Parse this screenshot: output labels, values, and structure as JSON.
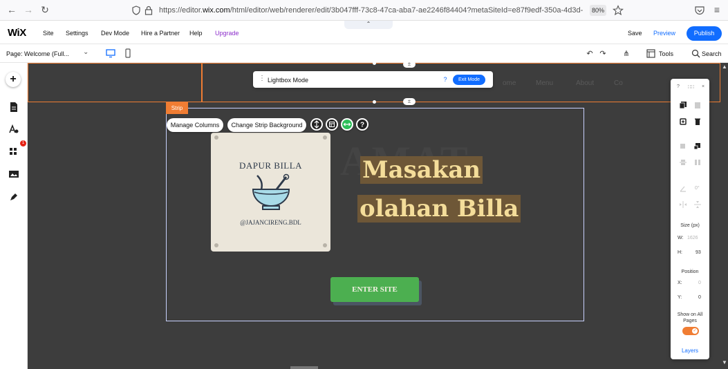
{
  "browser": {
    "url_prefix": "https://editor.",
    "url_domain": "wix.com",
    "url_rest": "/html/editor/web/renderer/edit/3b047fff-73c8-47ca-aba7-ae2246f84404?metaSiteId=e87f9edf-350a-4d3d-",
    "zoom": "80%"
  },
  "wix_bar": {
    "logo": "WiX",
    "menu": [
      "Site",
      "Settings",
      "Dev Mode",
      "Hire a Partner",
      "Help"
    ],
    "upgrade": "Upgrade",
    "save": "Save",
    "preview": "Preview",
    "publish": "Publish"
  },
  "toolbar": {
    "page": "Page: Welcome (Full...",
    "tools": "Tools",
    "search": "Search"
  },
  "left_rail": {
    "badge": "1"
  },
  "canvas": {
    "header_nav": [
      "ome",
      "Menu",
      "About",
      "Co"
    ],
    "lightbox": {
      "label": "Lightbox Mode",
      "help": "?",
      "exit": "Exit Mode"
    },
    "strip_tag": "Strip",
    "manage_columns": "Manage Columns",
    "change_bg": "Change Strip Background",
    "logo_title": "DAPUR BILLA",
    "logo_handle": "@JAJANCIRENG.BDL",
    "hero_background": "AMAT",
    "hero_line1": "Masakan",
    "hero_line2": "olahan Billa",
    "enter_site": "ENTER SITE"
  },
  "inspector": {
    "help": "?",
    "size_label": "Size (px)",
    "w_label": "W:",
    "w_value": "1626",
    "h_label": "H:",
    "h_value": "93",
    "position_label": "Position",
    "x_label": "X:",
    "x_value": "0",
    "y_label": "Y:",
    "y_value": "0",
    "rotation": "0°",
    "show_all": "Show on All Pages",
    "layers": "Layers"
  },
  "colors": {
    "accent": "#116dff",
    "selection": "#f07d33",
    "canvas": "#3d3d3d",
    "enter_button": "#4caf50",
    "hero_highlight": "#6e5737",
    "hero_text": "#f4dd9a"
  }
}
